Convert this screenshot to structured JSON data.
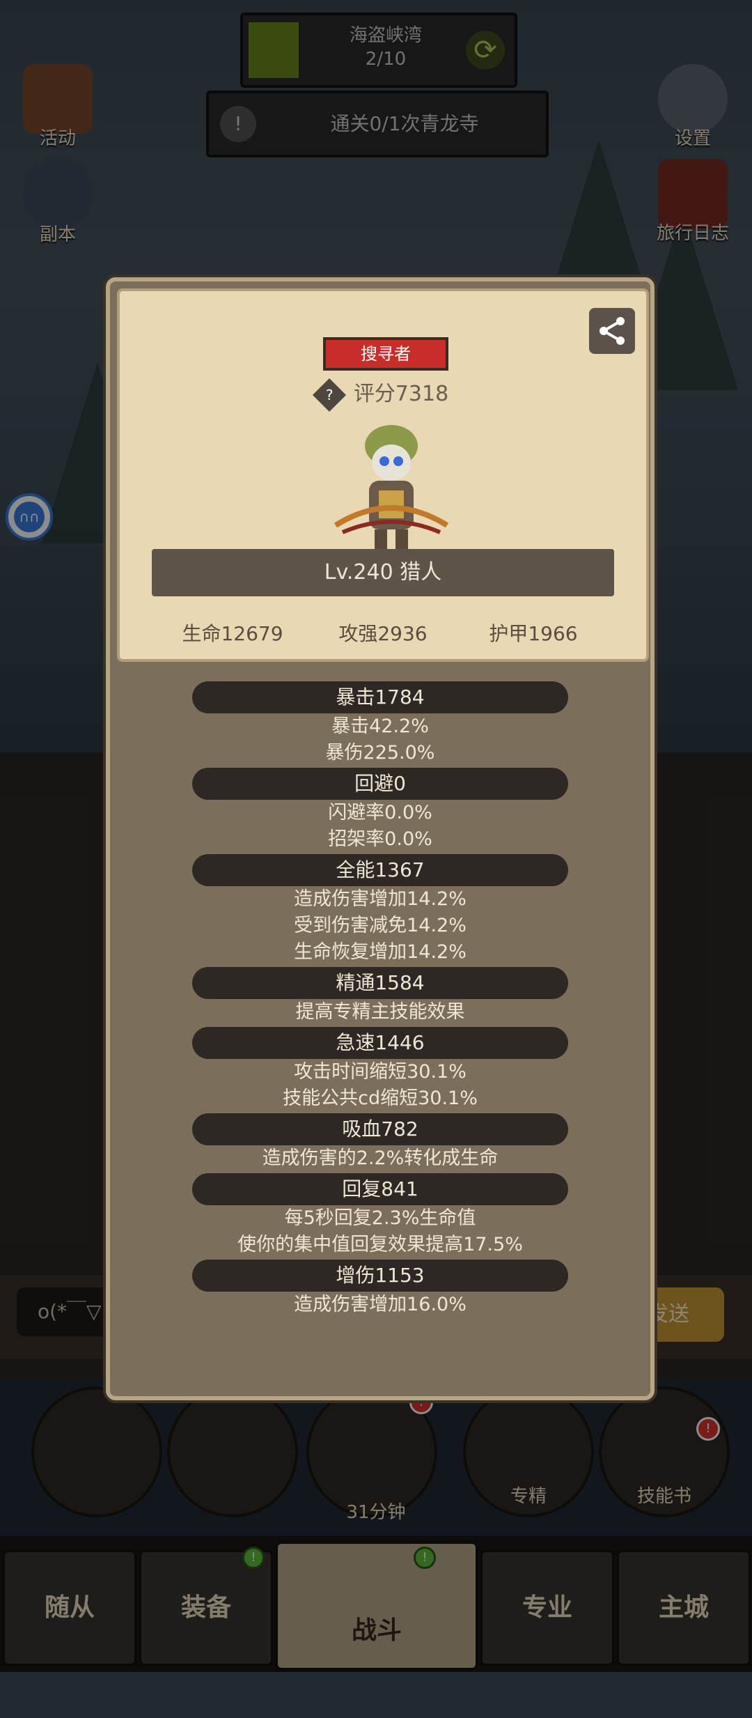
{
  "quest": {
    "name": "海盗峡湾",
    "progress": "2/10",
    "sub": "通关0/1次青龙寺"
  },
  "side_left": [
    {
      "label": "活动"
    },
    {
      "label": "副本"
    }
  ],
  "side_right": [
    {
      "label": "设置"
    },
    {
      "label": "旅行日志"
    }
  ],
  "float_ball": "∩∩",
  "chat": {
    "input_text": "o(*￣▽",
    "send_label": "发送"
  },
  "bottom_actions": {
    "timer": "31分钟",
    "specialization": "专精",
    "skill_book": "技能书"
  },
  "tabs": [
    "随从",
    "装备",
    "战斗",
    "专业",
    "主城"
  ],
  "profile": {
    "role_tag": "搜寻者",
    "score": "评分7318",
    "level_class": "Lv.240 猎人",
    "base_stats": [
      "生命12679",
      "攻强2936",
      "护甲1966"
    ]
  },
  "stats": [
    {
      "head": "暴击1784",
      "lines": [
        "暴击42.2%",
        "暴伤225.0%"
      ]
    },
    {
      "head": "回避0",
      "lines": [
        "闪避率0.0%",
        "招架率0.0%"
      ]
    },
    {
      "head": "全能1367",
      "lines": [
        "造成伤害增加14.2%",
        "受到伤害减免14.2%",
        "生命恢复增加14.2%"
      ]
    },
    {
      "head": "精通1584",
      "lines": [
        "提高专精主技能效果"
      ]
    },
    {
      "head": "急速1446",
      "lines": [
        "攻击时间缩短30.1%",
        "技能公共cd缩短30.1%"
      ]
    },
    {
      "head": "吸血782",
      "lines": [
        "造成伤害的2.2%转化成生命"
      ]
    },
    {
      "head": "回复841",
      "lines": [
        "每5秒回复2.3%生命值",
        "使你的集中值回复效果提高17.5%"
      ]
    },
    {
      "head": "增伤1153",
      "lines": [
        "造成伤害增加16.0%"
      ]
    }
  ]
}
